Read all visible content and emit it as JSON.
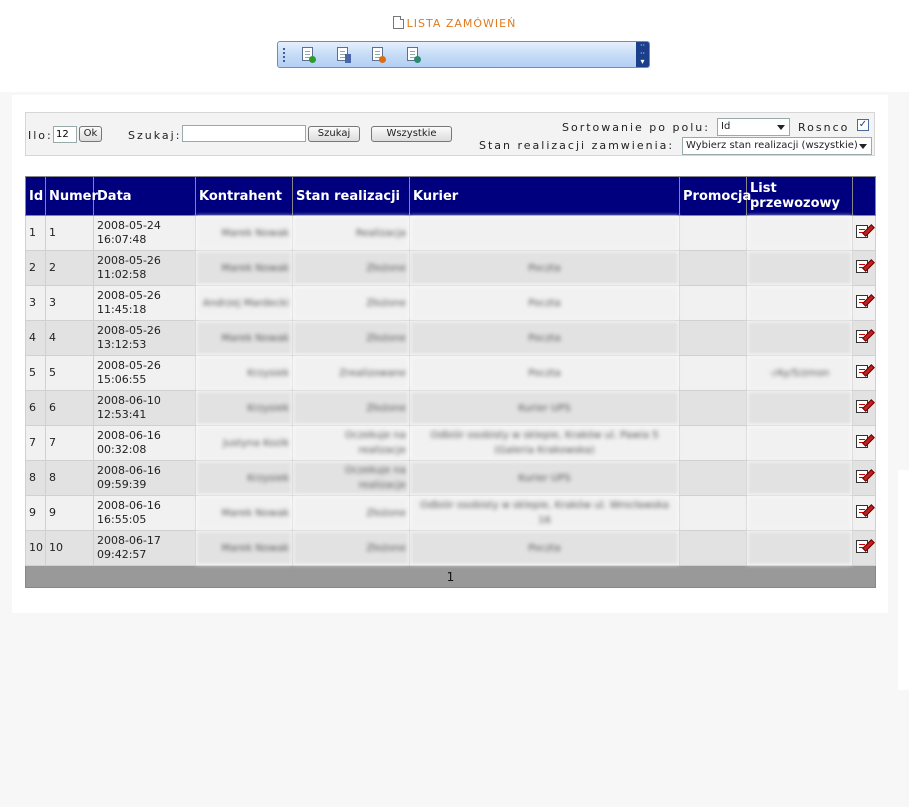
{
  "page": {
    "title": "LISTA ZAMÓWIEŃ",
    "title_icon": "document-icon"
  },
  "toolbar": {
    "buttons": [
      {
        "name": "add-order-button",
        "icon": "document-add-icon",
        "color": "#2e9a2e"
      },
      {
        "name": "list-orders-button",
        "icon": "document-list-icon",
        "color": "#4a66aa"
      },
      {
        "name": "delete-order-button",
        "icon": "document-delete-icon",
        "color": "#e06a10"
      },
      {
        "name": "export-order-button",
        "icon": "document-export-icon",
        "color": "#2a8a70"
      }
    ],
    "end_icon": "toolbar-overflow-icon"
  },
  "filters": {
    "ilo_label": "Ilo:",
    "ilo_value": "12",
    "ok_label": "Ok",
    "search_label": "Szukaj:",
    "search_value": "",
    "search_button": "Szukaj",
    "all_button": "Wszystkie",
    "sort_label": "Sortowanie po polu:",
    "sort_value": "Id",
    "asc_label": "Rosnco",
    "asc_checked": "✓",
    "status_label": "Stan realizacji zamwienia:",
    "status_value": "Wybierz stan realizacji (wszystkie)"
  },
  "table": {
    "headers": [
      "Id",
      "Numer",
      "Data",
      "Kontrahent",
      "Stan realizacji",
      "Kurier",
      "Promocja",
      "List przewozowy",
      ""
    ],
    "rows": [
      {
        "id": "1",
        "numer": "1",
        "date": "2008-05-24",
        "time": "16:07:48",
        "kontrahent": "Marek Nowak",
        "stan": "Realizacja",
        "kurier": "",
        "promocja": "",
        "list": ""
      },
      {
        "id": "2",
        "numer": "2",
        "date": "2008-05-26",
        "time": "11:02:58",
        "kontrahent": "Marek Nowak",
        "stan": "Złożone",
        "kurier": "Poczta",
        "promocja": "",
        "list": ""
      },
      {
        "id": "3",
        "numer": "3",
        "date": "2008-05-26",
        "time": "11:45:18",
        "kontrahent": "Andrzej Mardecki",
        "stan": "Złożone",
        "kurier": "Poczta",
        "promocja": "",
        "list": ""
      },
      {
        "id": "4",
        "numer": "4",
        "date": "2008-05-26",
        "time": "13:12:53",
        "kontrahent": "Marek Nowak",
        "stan": "Złożone",
        "kurier": "Poczta",
        "promocja": "",
        "list": ""
      },
      {
        "id": "5",
        "numer": "5",
        "date": "2008-05-26",
        "time": "15:06:55",
        "kontrahent": "Krzysiek",
        "stan": "Zrealizowane",
        "kurier": "Poczta",
        "promocja": "",
        "list": "-/4y/5/zmon"
      },
      {
        "id": "6",
        "numer": "6",
        "date": "2008-06-10",
        "time": "12:53:41",
        "kontrahent": "Krzysiek",
        "stan": "Złożone",
        "kurier": "Kurier UPS",
        "promocja": "",
        "list": ""
      },
      {
        "id": "7",
        "numer": "7",
        "date": "2008-06-16",
        "time": "00:32:08",
        "kontrahent": "Justyna Kozik",
        "stan": "Oczekuje na realizacje",
        "kurier": "Odbiór osobisty w sklepie, Kraków ul. Pawia 5 (Galeria Krakowska)",
        "promocja": "",
        "list": ""
      },
      {
        "id": "8",
        "numer": "8",
        "date": "2008-06-16",
        "time": "09:59:39",
        "kontrahent": "Krzysiek",
        "stan": "Oczekuje na realizacje",
        "kurier": "Kurier UPS",
        "promocja": "",
        "list": ""
      },
      {
        "id": "9",
        "numer": "9",
        "date": "2008-06-16",
        "time": "16:55:05",
        "kontrahent": "Marek Nowak",
        "stan": "Złożone",
        "kurier": "Odbiór osobisty w sklepie, Kraków ul. Wrocławska 16",
        "promocja": "",
        "list": ""
      },
      {
        "id": "10",
        "numer": "10",
        "date": "2008-06-17",
        "time": "09:42:57",
        "kontrahent": "Marek Nowak",
        "stan": "Złożone",
        "kurier": "Poczta",
        "promocja": "",
        "list": ""
      }
    ],
    "edit_icon": "edit-icon",
    "pagination": "1"
  },
  "colors": {
    "title": "#e07b1f",
    "header_bg": "#00007f",
    "row_odd": "#f1f1f1",
    "row_even": "#e2e2e2",
    "footer_bg": "#999999"
  }
}
